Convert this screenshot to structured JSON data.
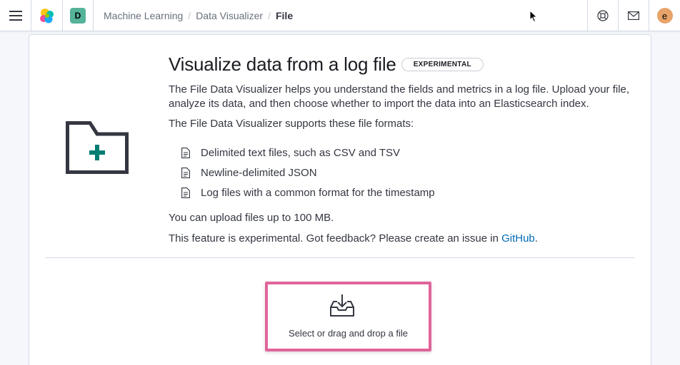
{
  "header": {
    "space_initial": "D",
    "user_initial": "e",
    "breadcrumbs": [
      "Machine Learning",
      "Data Visualizer",
      "File"
    ],
    "separator": "/"
  },
  "main": {
    "title": "Visualize data from a log file",
    "badge": "EXPERIMENTAL",
    "description": "The File Data Visualizer helps you understand the fields and metrics in a log file. Upload your file, analyze its data, and then choose whether to import the data into an Elasticsearch index.",
    "formats_intro": "The File Data Visualizer supports these file formats:",
    "formats": [
      "Delimited text files, such as CSV and TSV",
      "Newline-delimited JSON",
      "Log files with a common format for the timestamp"
    ],
    "size_note": "You can upload files up to 100 MB.",
    "experimental_note": "This feature is experimental. Got feedback? Please create an issue in ",
    "github_link": "GitHub",
    "period": "."
  },
  "dropzone": {
    "label": "Select or drag and drop a file"
  },
  "colors": {
    "accent_link": "#006bb8",
    "space_avatar": "#54b399",
    "user_avatar": "#e7a36a",
    "folder_plus": "#017d73",
    "dropzone_highlight": "#e0659a"
  },
  "icons": {
    "menu": "hamburger-icon",
    "logo": "elastic-logo-icon",
    "help": "help-lifebuoy-icon",
    "mail": "mail-icon",
    "folder": "folder-add-icon",
    "document": "document-icon",
    "upload": "download-tray-icon"
  }
}
